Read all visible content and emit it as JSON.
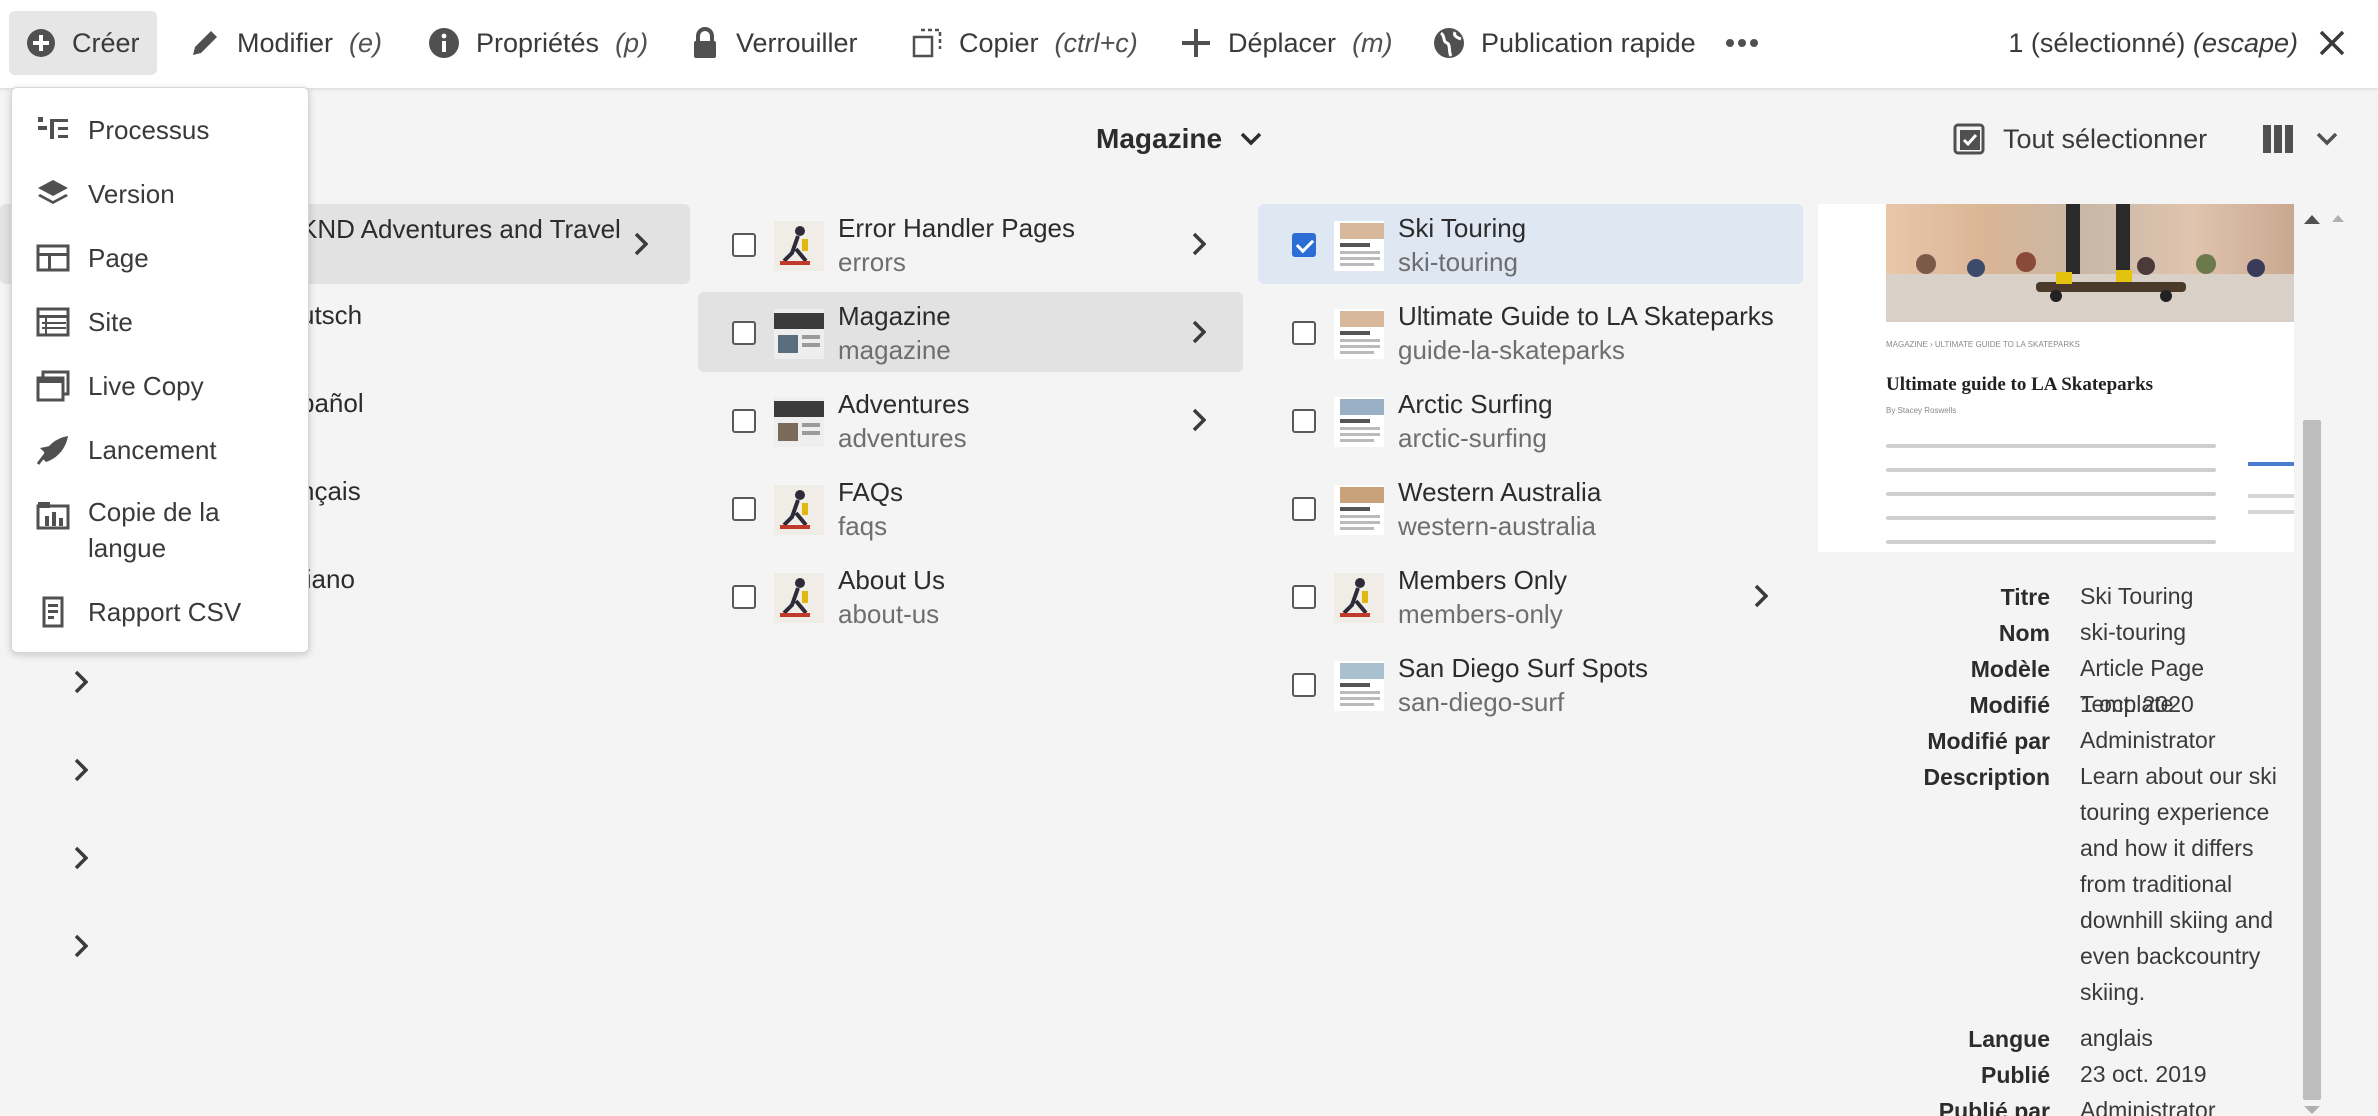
{
  "actionbar": {
    "create_label": "Créer",
    "edit_label": "Modifier",
    "edit_shortcut": "(e)",
    "properties_label": "Propriétés",
    "properties_shortcut": "(p)",
    "lock_label": "Verrouiller",
    "copy_label": "Copier",
    "copy_shortcut": "(ctrl+c)",
    "move_label": "Déplacer",
    "move_shortcut": "(m)",
    "quick_publish_label": "Publication rapide",
    "more_icon": "ellipsis-icon",
    "selected_text": "1 (sélectionné)",
    "selected_shortcut": "(escape)"
  },
  "create_menu": {
    "items": [
      {
        "label": "Processus",
        "icon": "workflow-icon"
      },
      {
        "label": "Version",
        "icon": "layers-icon"
      },
      {
        "label": "Page",
        "icon": "page-icon"
      },
      {
        "label": "Site",
        "icon": "site-icon"
      },
      {
        "label": "Live Copy",
        "icon": "livecopy-icon"
      },
      {
        "label": "Lancement",
        "icon": "launch-icon"
      },
      {
        "label": "Copie de la langue",
        "icon": "language-copy-icon"
      },
      {
        "label": "Rapport CSV",
        "icon": "csv-report-icon"
      }
    ]
  },
  "header": {
    "breadcrumb_label": "Magazine",
    "select_all_label": "Tout sélectionner"
  },
  "column0": {
    "items": [
      {
        "label": "KND Adventures and Travel"
      },
      {
        "label": "utsch"
      },
      {
        "label": "pañol"
      },
      {
        "label": "nçais"
      },
      {
        "label": "liano"
      }
    ]
  },
  "column1": {
    "items": [
      {
        "title": "Error Handler Pages",
        "name": "errors"
      },
      {
        "title": "Magazine",
        "name": "magazine"
      },
      {
        "title": "Adventures",
        "name": "adventures"
      },
      {
        "title": "FAQs",
        "name": "faqs"
      },
      {
        "title": "About Us",
        "name": "about-us"
      }
    ]
  },
  "column2": {
    "items": [
      {
        "title": "Ski Touring",
        "name": "ski-touring",
        "checked": true
      },
      {
        "title": "Ultimate Guide to LA Skateparks",
        "name": "guide-la-skateparks",
        "checked": false
      },
      {
        "title": "Arctic Surfing",
        "name": "arctic-surfing",
        "checked": false
      },
      {
        "title": "Western Australia",
        "name": "western-australia",
        "checked": false
      },
      {
        "title": "Members Only",
        "name": "members-only",
        "checked": false
      },
      {
        "title": "San Diego Surf Spots",
        "name": "san-diego-surf",
        "checked": false
      }
    ]
  },
  "preview": {
    "article_title": "Ultimate guide to LA Skateparks",
    "breadcrumb_text": "MAGAZINE  ›  ULTIMATE GUIDE TO LA SKATEPARKS",
    "byline": "By Stacey Roswells"
  },
  "details": {
    "rows": [
      {
        "label": "Titre",
        "value": "Ski Touring"
      },
      {
        "label": "Nom",
        "value": "ski-touring"
      },
      {
        "label": "Modèle",
        "value": "Article Page Template"
      },
      {
        "label": "Modifié",
        "value": "1 oct. 2020"
      },
      {
        "label": "Modifié par",
        "value": "Administrator"
      },
      {
        "label": "Description",
        "value": "Learn about our ski touring experience and how it differs from traditional downhill skiing and even backcountry skiing."
      },
      {
        "label": "Langue",
        "value": "anglais"
      },
      {
        "label": "Publié",
        "value": "23 oct. 2019"
      },
      {
        "label": "Publié par",
        "value": "Administrator"
      }
    ]
  },
  "colors": {
    "checkbox_checked": "#2c6ed5",
    "selected_row": "#dfe7f3",
    "active_row": "#e2e2e2"
  }
}
